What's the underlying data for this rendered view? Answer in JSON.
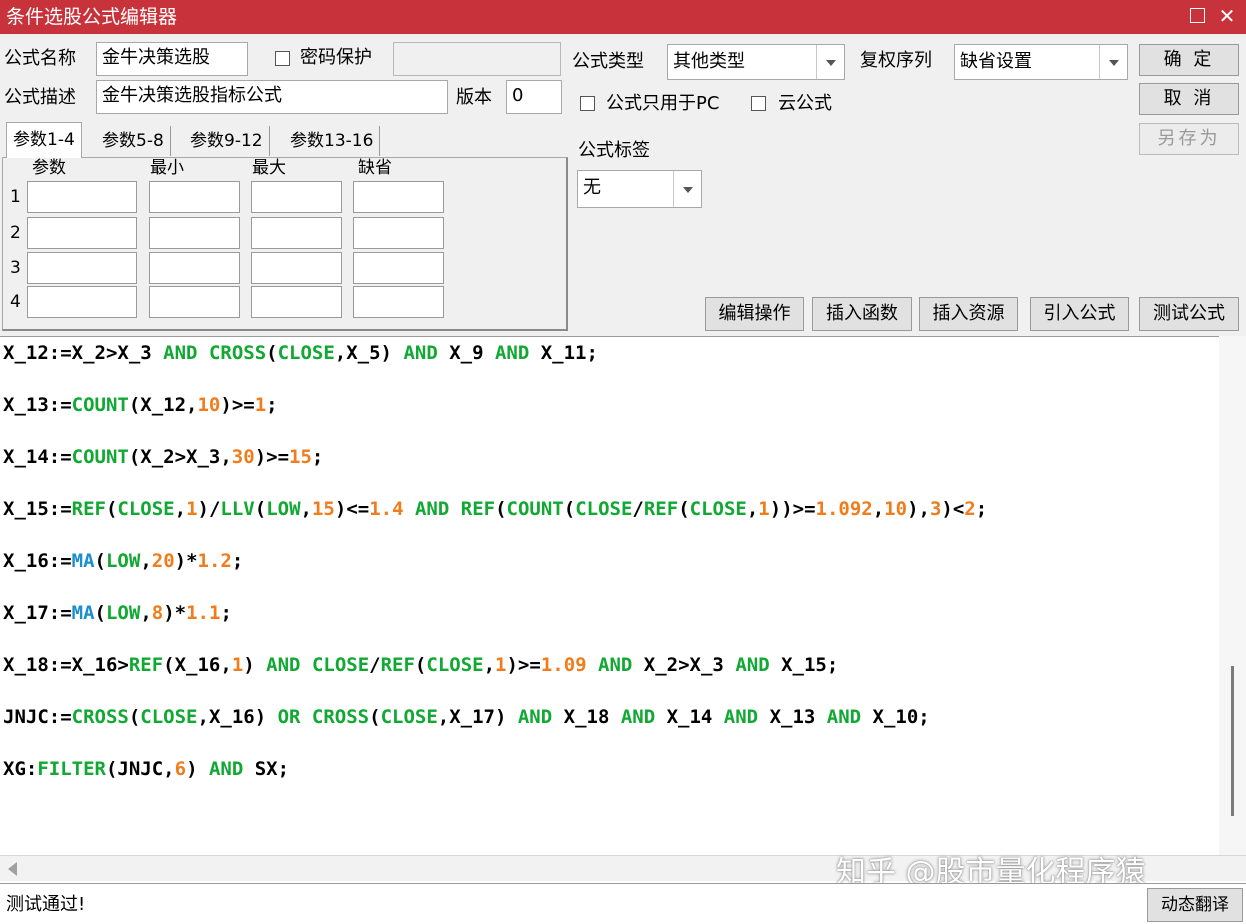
{
  "window": {
    "title": "条件选股公式编辑器"
  },
  "form": {
    "name_label": "公式名称",
    "name_value": "金牛决策选股",
    "password_label": "密码保护",
    "desc_label": "公式描述",
    "desc_value": "金牛决策选股指标公式",
    "version_label": "版本",
    "version_value": "0",
    "type_label": "公式类型",
    "type_value": "其他类型",
    "rights_label": "复权序列",
    "rights_value": "缺省设置",
    "pc_only_label": "公式只用于PC",
    "cloud_label": "云公式",
    "tag_label": "公式标签",
    "tag_value": "无"
  },
  "buttons": {
    "ok": "确 定",
    "cancel": "取 消",
    "save_as": "另存为",
    "edit_ops": "编辑操作",
    "insert_func": "插入函数",
    "insert_res": "插入资源",
    "import_formula": "引入公式",
    "test_formula": "测试公式",
    "dynamic_translate": "动态翻译"
  },
  "params": {
    "tabs": [
      "参数1-4",
      "参数5-8",
      "参数9-12",
      "参数13-16"
    ],
    "headers": [
      "参数",
      "最小",
      "最大",
      "缺省"
    ],
    "rows": [
      "1",
      "2",
      "3",
      "4"
    ]
  },
  "code": [
    [
      [
        "t",
        "X_12:=X_2>X_3 "
      ],
      [
        "k",
        "AND"
      ],
      [
        "t",
        " "
      ],
      [
        "k",
        "CROSS"
      ],
      [
        "t",
        "("
      ],
      [
        "k",
        "CLOSE"
      ],
      [
        "t",
        ",X_5) "
      ],
      [
        "k",
        "AND"
      ],
      [
        "t",
        " X_9 "
      ],
      [
        "k",
        "AND"
      ],
      [
        "t",
        " X_11;"
      ]
    ],
    [
      [
        "t",
        "X_13:="
      ],
      [
        "k",
        "COUNT"
      ],
      [
        "t",
        "(X_12,"
      ],
      [
        "n",
        "10"
      ],
      [
        "t",
        ")>="
      ],
      [
        "n",
        "1"
      ],
      [
        "t",
        ";"
      ]
    ],
    [
      [
        "t",
        "X_14:="
      ],
      [
        "k",
        "COUNT"
      ],
      [
        "t",
        "(X_2>X_3,"
      ],
      [
        "n",
        "30"
      ],
      [
        "t",
        ")>="
      ],
      [
        "n",
        "15"
      ],
      [
        "t",
        ";"
      ]
    ],
    [
      [
        "t",
        "X_15:="
      ],
      [
        "k",
        "REF"
      ],
      [
        "t",
        "("
      ],
      [
        "k",
        "CLOSE"
      ],
      [
        "t",
        ","
      ],
      [
        "n",
        "1"
      ],
      [
        "t",
        ")/"
      ],
      [
        "k",
        "LLV"
      ],
      [
        "t",
        "("
      ],
      [
        "k",
        "LOW"
      ],
      [
        "t",
        ","
      ],
      [
        "n",
        "15"
      ],
      [
        "t",
        ")<="
      ],
      [
        "n",
        "1.4"
      ],
      [
        "t",
        " "
      ],
      [
        "k",
        "AND"
      ],
      [
        "t",
        " "
      ],
      [
        "k",
        "REF"
      ],
      [
        "t",
        "("
      ],
      [
        "k",
        "COUNT"
      ],
      [
        "t",
        "("
      ],
      [
        "k",
        "CLOSE"
      ],
      [
        "t",
        "/"
      ],
      [
        "k",
        "REF"
      ],
      [
        "t",
        "("
      ],
      [
        "k",
        "CLOSE"
      ],
      [
        "t",
        ","
      ],
      [
        "n",
        "1"
      ],
      [
        "t",
        "))>="
      ],
      [
        "n",
        "1.092"
      ],
      [
        "t",
        ","
      ],
      [
        "n",
        "10"
      ],
      [
        "t",
        "),"
      ],
      [
        "n",
        "3"
      ],
      [
        "t",
        ")<"
      ],
      [
        "n",
        "2"
      ],
      [
        "t",
        ";"
      ]
    ],
    [
      [
        "t",
        "X_16:="
      ],
      [
        "f",
        "MA"
      ],
      [
        "t",
        "("
      ],
      [
        "k",
        "LOW"
      ],
      [
        "t",
        ","
      ],
      [
        "n",
        "20"
      ],
      [
        "t",
        ")*"
      ],
      [
        "n",
        "1.2"
      ],
      [
        "t",
        ";"
      ]
    ],
    [
      [
        "t",
        "X_17:="
      ],
      [
        "f",
        "MA"
      ],
      [
        "t",
        "("
      ],
      [
        "k",
        "LOW"
      ],
      [
        "t",
        ","
      ],
      [
        "n",
        "8"
      ],
      [
        "t",
        ")*"
      ],
      [
        "n",
        "1.1"
      ],
      [
        "t",
        ";"
      ]
    ],
    [
      [
        "t",
        "X_18:=X_16>"
      ],
      [
        "k",
        "REF"
      ],
      [
        "t",
        "(X_16,"
      ],
      [
        "n",
        "1"
      ],
      [
        "t",
        ") "
      ],
      [
        "k",
        "AND"
      ],
      [
        "t",
        " "
      ],
      [
        "k",
        "CLOSE"
      ],
      [
        "t",
        "/"
      ],
      [
        "k",
        "REF"
      ],
      [
        "t",
        "("
      ],
      [
        "k",
        "CLOSE"
      ],
      [
        "t",
        ","
      ],
      [
        "n",
        "1"
      ],
      [
        "t",
        ")>="
      ],
      [
        "n",
        "1.09"
      ],
      [
        "t",
        " "
      ],
      [
        "k",
        "AND"
      ],
      [
        "t",
        " X_2>X_3 "
      ],
      [
        "k",
        "AND"
      ],
      [
        "t",
        " X_15;"
      ]
    ],
    [
      [
        "t",
        "JNJC:="
      ],
      [
        "k",
        "CROSS"
      ],
      [
        "t",
        "("
      ],
      [
        "k",
        "CLOSE"
      ],
      [
        "t",
        ",X_16) "
      ],
      [
        "k",
        "OR"
      ],
      [
        "t",
        " "
      ],
      [
        "k",
        "CROSS"
      ],
      [
        "t",
        "("
      ],
      [
        "k",
        "CLOSE"
      ],
      [
        "t",
        ",X_17) "
      ],
      [
        "k",
        "AND"
      ],
      [
        "t",
        " X_18 "
      ],
      [
        "k",
        "AND"
      ],
      [
        "t",
        " X_14 "
      ],
      [
        "k",
        "AND"
      ],
      [
        "t",
        " X_13 "
      ],
      [
        "k",
        "AND"
      ],
      [
        "t",
        " X_10;"
      ]
    ],
    [
      [
        "t",
        "XG:"
      ],
      [
        "k",
        "FILTER"
      ],
      [
        "t",
        "(JNJC,"
      ],
      [
        "n",
        "6"
      ],
      [
        "t",
        ") "
      ],
      [
        "k",
        "AND"
      ],
      [
        "t",
        " SX;"
      ]
    ]
  ],
  "watermark": "知乎 @股市量化程序猿",
  "status": {
    "message": "测试通过!"
  }
}
